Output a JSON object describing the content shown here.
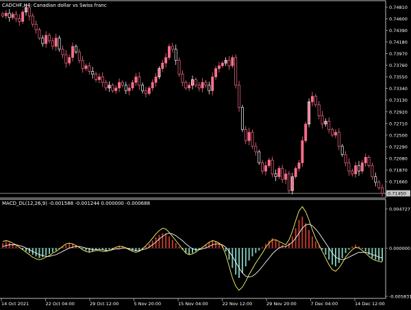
{
  "main_panel": {
    "title": "CADCHF,H4: Canadian dollar vs Swiss franc",
    "current_price": "0.71450",
    "price_line_value": 0.7145,
    "price_axis_labels": [
      {
        "value": 0.7481,
        "label": "0.74810"
      },
      {
        "value": 0.746,
        "label": "0.74600"
      },
      {
        "value": 0.7439,
        "label": "0.74390"
      },
      {
        "value": 0.7418,
        "label": "0.74180"
      },
      {
        "value": 0.7397,
        "label": "0.73970"
      },
      {
        "value": 0.7376,
        "label": "0.73760"
      },
      {
        "value": 0.7355,
        "label": "0.73550"
      },
      {
        "value": 0.7334,
        "label": "0.73340"
      },
      {
        "value": 0.7313,
        "label": "0.73130"
      },
      {
        "value": 0.7292,
        "label": "0.72920"
      },
      {
        "value": 0.7271,
        "label": "0.72710"
      },
      {
        "value": 0.725,
        "label": "0.72500"
      },
      {
        "value": 0.7229,
        "label": "0.72290"
      },
      {
        "value": 0.7208,
        "label": "0.72080"
      },
      {
        "value": 0.7187,
        "label": "0.71870"
      },
      {
        "value": 0.7166,
        "label": "0.71660"
      },
      {
        "value": 0.7145,
        "label": "0.71450"
      }
    ]
  },
  "indicator_panel": {
    "title": "MACD_DL(12,26,9) -0.001588 -0.001244 0.000000 -0.000688",
    "axis_labels": [
      {
        "value": 0.004727,
        "label": "0.004727"
      },
      {
        "value": 0.0,
        "label": "0.000000"
      },
      {
        "value": -0.005831,
        "label": "-0.005831"
      }
    ]
  },
  "time_axis": [
    "14 Oct 2021",
    "22 Oct 04:00",
    "29 Oct 12:00",
    "5 Nov 20:00",
    "15 Nov 04:00",
    "22 Nov 12:00",
    "29 Nov 20:00",
    "7 Dec 04:00",
    "14 Dec 12:00"
  ],
  "colors": {
    "background": "#000000",
    "candle": "#ff6e8a",
    "candle_alt": "#ffffff",
    "grid_line": "#c0c0c0",
    "price_marker_bg": "#c8c8c8",
    "hist_positive": "#c0392b",
    "hist_negative": "#7fc7b5",
    "macd_line": "#ffff66",
    "signal_line": "#ffffff"
  },
  "chart_data": [
    {
      "type": "candlestick",
      "title": "CADCHF,H4: Canadian dollar vs Swiss franc",
      "ylim": [
        0.7139,
        0.749
      ],
      "close_series": [
        0.7465,
        0.747,
        0.7462,
        0.7468,
        0.746,
        0.7455,
        0.7472,
        0.748,
        0.7465,
        0.745,
        0.744,
        0.7425,
        0.7415,
        0.743,
        0.742,
        0.741,
        0.7425,
        0.7405,
        0.7395,
        0.738,
        0.739,
        0.741,
        0.74,
        0.7385,
        0.737,
        0.7375,
        0.7365,
        0.736,
        0.735,
        0.7355,
        0.7345,
        0.7335,
        0.734,
        0.733,
        0.7335,
        0.7345,
        0.734,
        0.733,
        0.7335,
        0.7345,
        0.7355,
        0.734,
        0.733,
        0.7325,
        0.7335,
        0.7345,
        0.7355,
        0.737,
        0.738,
        0.739,
        0.741,
        0.7405,
        0.7385,
        0.736,
        0.7345,
        0.7335,
        0.734,
        0.735,
        0.734,
        0.7335,
        0.7345,
        0.734,
        0.733,
        0.7355,
        0.737,
        0.7375,
        0.738,
        0.7385,
        0.7375,
        0.739,
        0.734,
        0.73,
        0.726,
        0.724,
        0.7255,
        0.723,
        0.722,
        0.72,
        0.7185,
        0.7195,
        0.7205,
        0.718,
        0.7175,
        0.719,
        0.717,
        0.718,
        0.715,
        0.7175,
        0.719,
        0.72,
        0.724,
        0.727,
        0.731,
        0.732,
        0.7305,
        0.7285,
        0.727,
        0.7275,
        0.726,
        0.725,
        0.7255,
        0.723,
        0.7215,
        0.72,
        0.7185,
        0.718,
        0.7195,
        0.7185,
        0.72,
        0.721,
        0.7195,
        0.7175,
        0.7165,
        0.7155,
        0.7145
      ]
    },
    {
      "type": "bar",
      "title": "MACD_DL(12,26,9) -0.001588 -0.001244 0.000000 -0.000688",
      "ylim": [
        -0.005831,
        0.004727
      ],
      "histogram": [
        0.0006,
        0.0008,
        0.0007,
        0.0005,
        0.0003,
        0.0001,
        -0.0002,
        -0.0004,
        -0.0006,
        -0.0008,
        -0.001,
        -0.0012,
        -0.0011,
        -0.0009,
        -0.0007,
        -0.0005,
        -0.0003,
        -0.0001,
        0.0002,
        0.0004,
        0.0006,
        0.0005,
        0.0003,
        0.0001,
        -0.0001,
        -0.0003,
        -0.0005,
        -0.0004,
        -0.0002,
        -0.0001,
        -0.0002,
        -0.0003,
        -0.0002,
        -0.0001,
        0.0001,
        0.0003,
        0.0002,
        0.0001,
        -0.0001,
        -0.0003,
        -0.0004,
        -0.0003,
        -0.0001,
        0.0002,
        0.0005,
        0.0009,
        0.0013,
        0.0016,
        0.0018,
        0.0017,
        0.0014,
        0.001,
        0.0006,
        0.0002,
        -0.0002,
        -0.0006,
        -0.0008,
        -0.0006,
        -0.0004,
        -0.0002,
        0.0001,
        0.0004,
        0.0007,
        0.0009,
        0.0008,
        0.0006,
        0.0003,
        -0.0004,
        -0.0014,
        -0.0024,
        -0.0032,
        -0.0036,
        -0.003,
        -0.0022,
        -0.0015,
        -0.001,
        -0.0006,
        -0.0003,
        0.0001,
        0.0005,
        0.0009,
        0.0012,
        0.001,
        0.0007,
        0.0004,
        0.0002,
        0.0006,
        0.0014,
        0.0024,
        0.0034,
        0.0038,
        0.003,
        0.0022,
        0.0014,
        0.0008,
        0.0003,
        -0.0002,
        -0.0008,
        -0.0014,
        -0.002,
        -0.0022,
        -0.0018,
        -0.0012,
        -0.0006,
        -0.0002,
        0.0002,
        0.0004,
        0.0002,
        -0.0001,
        -0.0004,
        -0.0008,
        -0.0012,
        -0.0014,
        -0.0015,
        -0.0016
      ],
      "macd_line": [
        0.0008,
        0.0009,
        0.0008,
        0.0006,
        0.0004,
        0.0001,
        -0.0002,
        -0.0005,
        -0.0008,
        -0.0011,
        -0.0013,
        -0.0014,
        -0.0013,
        -0.0011,
        -0.0009,
        -0.0006,
        -0.0004,
        -0.0001,
        0.0002,
        0.0005,
        0.0006,
        0.0005,
        0.0003,
        0.0001,
        -0.0002,
        -0.0004,
        -0.0005,
        -0.0004,
        -0.0003,
        -0.0003,
        -0.0004,
        -0.0004,
        -0.0003,
        -0.0001,
        0.0001,
        0.0002,
        0.0002,
        0.0,
        -0.0002,
        -0.0004,
        -0.0005,
        -0.0004,
        -0.0001,
        0.0003,
        0.0007,
        0.0012,
        0.0017,
        0.0021,
        0.0024,
        0.0023,
        0.0019,
        0.0014,
        0.0009,
        0.0004,
        -0.0001,
        -0.0006,
        -0.0008,
        -0.0007,
        -0.0005,
        -0.0002,
        0.0001,
        0.0004,
        0.0007,
        0.0009,
        0.0008,
        0.0006,
        0.0002,
        -0.0008,
        -0.0022,
        -0.0036,
        -0.0046,
        -0.0051,
        -0.0047,
        -0.004,
        -0.0032,
        -0.0025,
        -0.0018,
        -0.0012,
        -0.0006,
        0.0001,
        0.0006,
        0.001,
        0.001,
        0.0008,
        0.0006,
        0.0004,
        0.001,
        0.002,
        0.0033,
        0.0045,
        0.005,
        0.0044,
        0.0034,
        0.0022,
        0.0012,
        0.0004,
        -0.0004,
        -0.0012,
        -0.002,
        -0.0026,
        -0.0028,
        -0.0024,
        -0.0018,
        -0.0011,
        -0.0006,
        -0.0002,
        0.0001,
        0.0,
        -0.0003,
        -0.0006,
        -0.001,
        -0.0013,
        -0.0015,
        -0.0016,
        -0.0017
      ],
      "signal_line": [
        0.0002,
        0.0003,
        0.0004,
        0.0004,
        0.0004,
        0.0003,
        0.0002,
        0.0,
        -0.0002,
        -0.0004,
        -0.0006,
        -0.0008,
        -0.0009,
        -0.001,
        -0.001,
        -0.0009,
        -0.0008,
        -0.0006,
        -0.0004,
        -0.0002,
        0.0,
        0.0001,
        0.0002,
        0.0002,
        0.0001,
        0.0,
        -0.0001,
        -0.0002,
        -0.0002,
        -0.0002,
        -0.0002,
        -0.0003,
        -0.0003,
        -0.0002,
        -0.0001,
        -0.0001,
        0.0,
        0.0,
        -0.0001,
        -0.0002,
        -0.0003,
        -0.0003,
        -0.0002,
        -0.0001,
        0.0001,
        0.0004,
        0.0007,
        0.0011,
        0.0014,
        0.0017,
        0.0018,
        0.0017,
        0.0015,
        0.0012,
        0.0009,
        0.0005,
        0.0002,
        -0.0001,
        -0.0002,
        -0.0002,
        -0.0001,
        0.0,
        0.0002,
        0.0004,
        0.0005,
        0.0005,
        0.0004,
        0.0001,
        -0.0004,
        -0.001,
        -0.0017,
        -0.0024,
        -0.003,
        -0.0034,
        -0.0035,
        -0.0034,
        -0.0031,
        -0.0027,
        -0.0022,
        -0.0017,
        -0.0012,
        -0.0007,
        -0.0003,
        0.0,
        0.0002,
        0.0002,
        0.0004,
        0.0007,
        0.0012,
        0.0018,
        0.0024,
        0.0028,
        0.0029,
        0.0027,
        0.0023,
        0.0018,
        0.0012,
        0.0006,
        0.0,
        -0.0006,
        -0.0011,
        -0.0013,
        -0.0014,
        -0.0013,
        -0.0011,
        -0.0009,
        -0.0007,
        -0.0005,
        -0.0005,
        -0.0005,
        -0.0006,
        -0.0008,
        -0.0009,
        -0.0011,
        -0.0012
      ]
    }
  ]
}
